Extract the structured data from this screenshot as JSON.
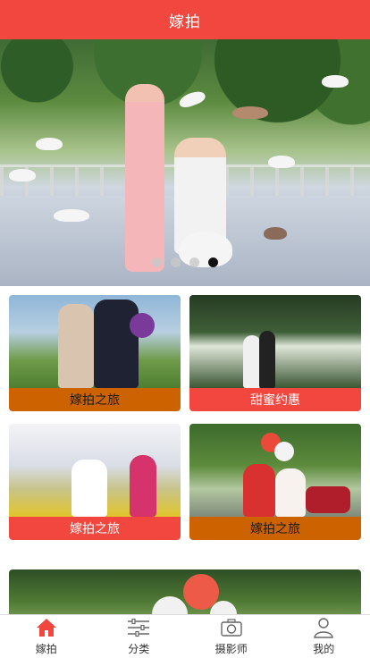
{
  "header": {
    "title": "嫁拍"
  },
  "banner": {
    "slides": 4,
    "active_slide": 4
  },
  "cards": [
    {
      "label": "嫁拍之旅",
      "style": "orange"
    },
    {
      "label": "甜蜜约惠",
      "style": "red"
    },
    {
      "label": "嫁拍之旅",
      "style": "red"
    },
    {
      "label": "嫁拍之旅",
      "style": "orange"
    }
  ],
  "tabbar": {
    "items": [
      {
        "label": "嫁拍",
        "icon": "home-icon",
        "active": true
      },
      {
        "label": "分类",
        "icon": "sliders-icon",
        "active": false
      },
      {
        "label": "摄影师",
        "icon": "camera-icon",
        "active": false
      },
      {
        "label": "我的",
        "icon": "user-icon",
        "active": false
      }
    ]
  },
  "colors": {
    "brand": "#f2473f",
    "orange": "#cc6200"
  }
}
